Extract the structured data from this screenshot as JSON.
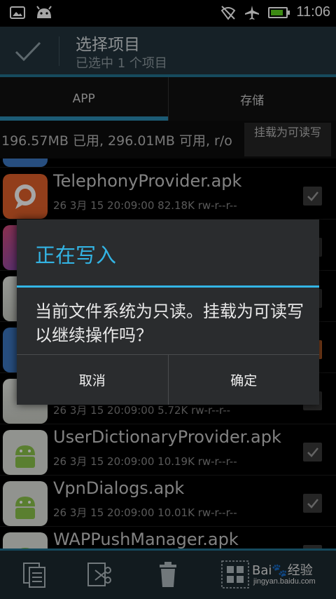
{
  "status_bar": {
    "time": "11:06",
    "battery_level": 0.85,
    "icons": [
      "image-icon",
      "android-icon",
      "no-signal-icon",
      "airplane-icon",
      "battery-icon"
    ]
  },
  "action_bar": {
    "title": "选择项目",
    "subtitle": "已选中 1 个项目"
  },
  "tabs": [
    {
      "label": "APP",
      "active": true
    },
    {
      "label": "存储",
      "active": false
    }
  ],
  "info_bar": {
    "text": "196.57MB 已用, 296.01MB 可用, r/o",
    "mount_button": "挂载为可读写"
  },
  "files": [
    {
      "name": "TelephonyProvider.apk",
      "meta": "26 3月 15 20:09:00  82.18K  rw-r--r--",
      "icon": "orange-chat-icon",
      "checked": true
    },
    {
      "name": "",
      "meta": "",
      "icon": "purple-app-icon",
      "checked": true
    },
    {
      "name": "",
      "meta": "",
      "icon": "android-icon",
      "checked": true
    },
    {
      "name": "",
      "meta": "",
      "icon": "blue-app-icon",
      "checked": true
    },
    {
      "name": "",
      "meta": "26 3月 15 20:09:00  5.72K  rw-r--r--",
      "icon": "android-icon",
      "checked": true
    },
    {
      "name": "UserDictionaryProvider.apk",
      "meta": "26 3月 15 20:09:00  10.19K  rw-r--r--",
      "icon": "android-icon",
      "checked": true
    },
    {
      "name": "VpnDialogs.apk",
      "meta": "26 3月 15 20:09:00  10.01K  rw-r--r--",
      "icon": "android-icon",
      "checked": true
    },
    {
      "name": "WAPPushManager.apk",
      "meta": "",
      "icon": "android-icon",
      "checked": true
    }
  ],
  "dialog": {
    "title": "正在写入",
    "message": "当前文件系统为只读。挂载为可读写以继续操作吗？",
    "cancel": "取消",
    "confirm": "确定"
  },
  "bottom_bar": {
    "icons": [
      "copy-icon",
      "cut-icon",
      "delete-icon",
      "select-grid-icon"
    ],
    "watermark": "Bai🐾经验",
    "watermark_url": "jingyan.baidu.com"
  },
  "colors": {
    "accent": "#33b5e5",
    "actionbar": "#23343c",
    "tab_indicator": "#2b8db4"
  }
}
